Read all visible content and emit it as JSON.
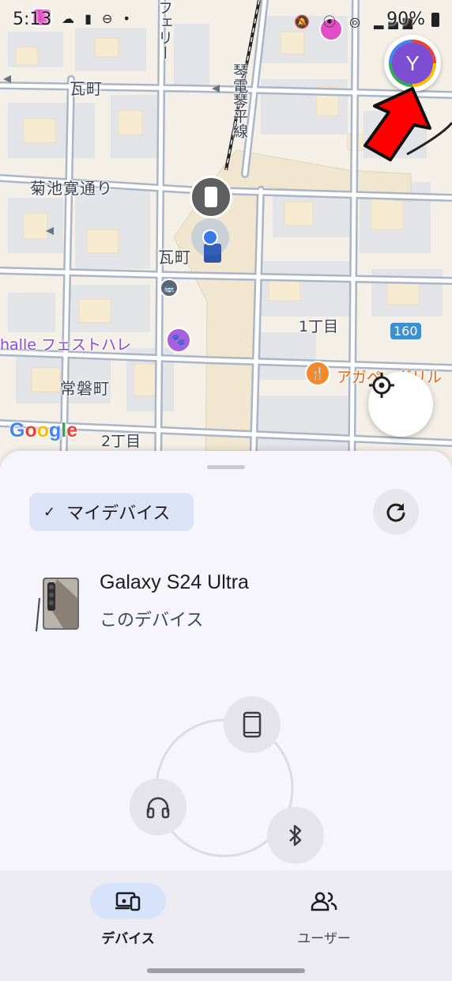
{
  "status_bar": {
    "time": "5:13",
    "left_icons": [
      "10%",
      "sim-icon",
      "dnd-icon",
      "dot"
    ],
    "right_icons": [
      "mute-icon",
      "location-icon",
      "hotspot-icon",
      "5G",
      "signal-icon"
    ],
    "battery": "90%"
  },
  "map": {
    "labels": {
      "kawaramachi_nw": "瓦町",
      "ferry": "フェリー",
      "kotoden_line": "琴電琴平線",
      "kikuchikan": "菊池寛通り",
      "kawaramachi_station": "瓦町",
      "festhalle": "halle フェストハレ",
      "itchome": "1丁目",
      "route": "160",
      "agape": "アガペ・グリル",
      "tokiwamachi": "常磐町",
      "nichome": "2丁目"
    },
    "google_logo": "Google"
  },
  "account": {
    "avatar_initial": "Y"
  },
  "sheet": {
    "filter_chip": {
      "check": "✓",
      "label": "マイデバイス"
    },
    "device": {
      "name": "Galaxy S24 Ultra",
      "subtitle": "このデバイス"
    },
    "radar_nodes": [
      "phone-icon",
      "headphones-icon",
      "bluetooth-icon"
    ]
  },
  "nav": {
    "items": [
      {
        "label": "デバイス",
        "icon": "devices-icon",
        "active": true
      },
      {
        "label": "ユーザー",
        "icon": "people-icon",
        "active": false
      }
    ]
  },
  "colors": {
    "accent_chip": "#dde3f6",
    "avatar_bg": "#7d4ed1",
    "annotation_arrow": "#ff0000"
  }
}
